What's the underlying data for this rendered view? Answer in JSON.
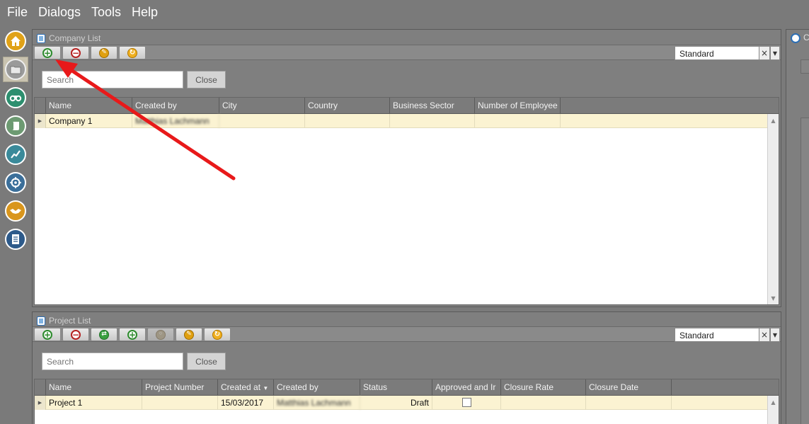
{
  "menu": [
    "File",
    "Dialogs",
    "Tools",
    "Help"
  ],
  "nav": {
    "items": [
      {
        "name": "home",
        "icon": "home-icon",
        "color": "#e0a218"
      },
      {
        "name": "folder",
        "icon": "folder-icon",
        "color": "#c9c3b0",
        "active": true
      },
      {
        "name": "binoculars",
        "icon": "binoculars-icon",
        "color": "#2d8f6f"
      },
      {
        "name": "scroll",
        "icon": "scroll-icon",
        "color": "#6d9a72"
      },
      {
        "name": "chart",
        "icon": "chart-trend-icon",
        "color": "#3a8a9a"
      },
      {
        "name": "target",
        "icon": "target-icon",
        "color": "#3b6f9a"
      },
      {
        "name": "handshake",
        "icon": "handshake-icon",
        "color": "#d9961d"
      },
      {
        "name": "document",
        "icon": "document-list-icon",
        "color": "#2d5a8a"
      }
    ]
  },
  "company_list": {
    "title": "Company List",
    "toolbar": [
      "add-icon",
      "remove-icon",
      "wrench-icon",
      "refresh-icon"
    ],
    "view": "Standard",
    "search_placeholder": "Search",
    "close_label": "Close",
    "columns": [
      "Name",
      "Created by",
      "City",
      "Country",
      "Business Sector",
      "Number of Employee"
    ],
    "rows": [
      {
        "name": "Company 1",
        "created_by": "Matthias Lachmann",
        "city": "",
        "country": "",
        "sector": "",
        "employees": ""
      }
    ]
  },
  "project_list": {
    "title": "Project List",
    "toolbar": [
      "add-icon",
      "remove-icon",
      "green-icon",
      "copy-icon",
      "disabled-icon",
      "wrench-icon",
      "refresh-icon"
    ],
    "view": "Standard",
    "search_placeholder": "Search",
    "close_label": "Close",
    "columns": [
      "Name",
      "Project Number",
      "Created at",
      "Created by",
      "Status",
      "Approved and Ir",
      "Closure Rate",
      "Closure Date"
    ],
    "rows": [
      {
        "name": "Project 1",
        "number": "",
        "created_at": "15/03/2017",
        "created_by": "Matthias Lachmann",
        "status": "Draft",
        "approved": false,
        "closure_rate": "",
        "closure_date": ""
      }
    ]
  },
  "right_panel": {
    "title": "C"
  },
  "annotation_color": "#e8191a"
}
